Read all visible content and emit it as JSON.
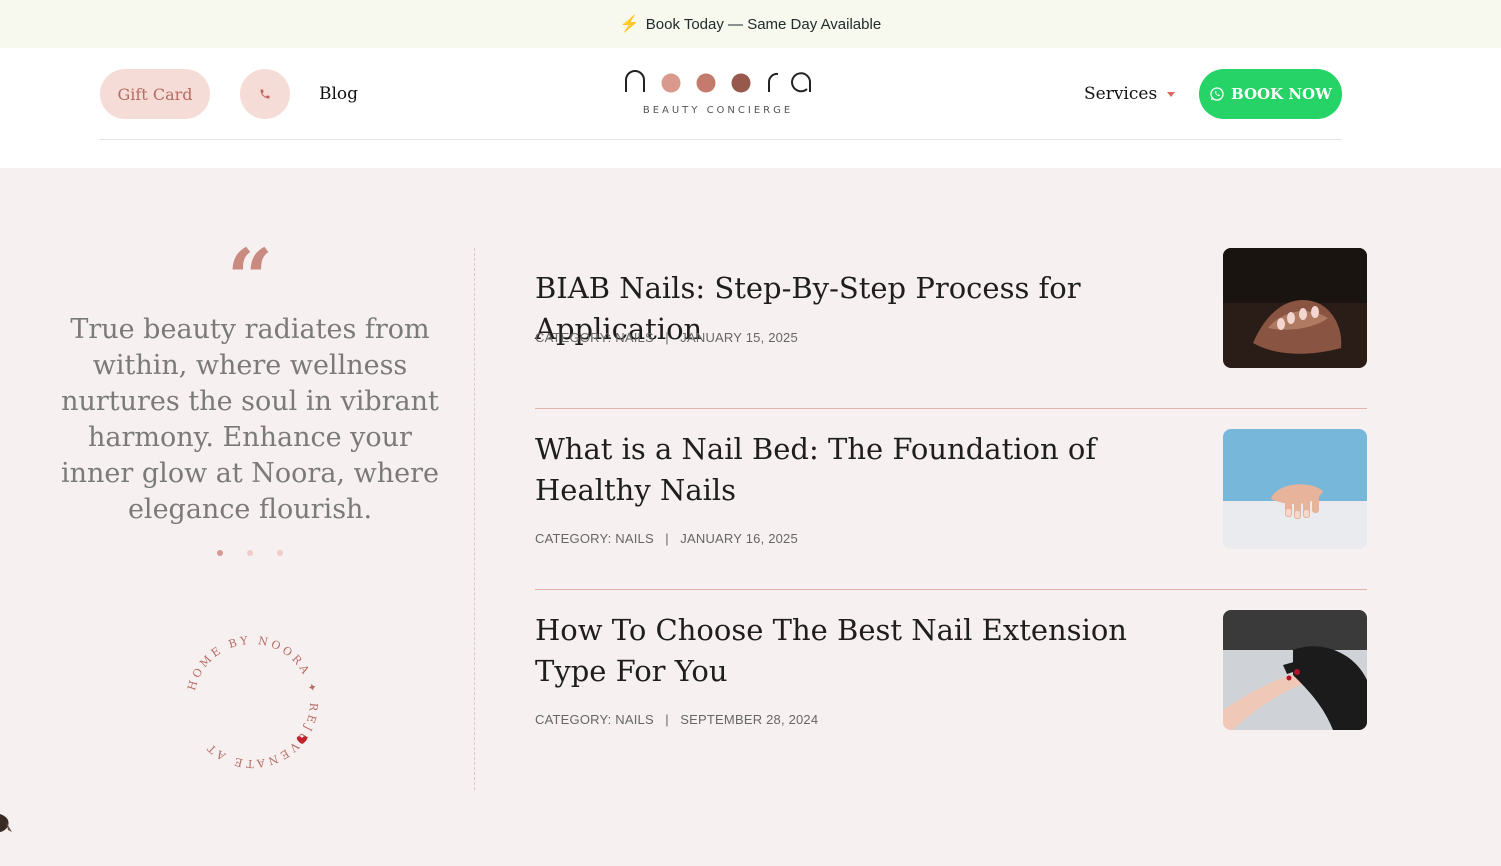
{
  "announcement": {
    "icon": "lightning-icon",
    "text": "Book Today — Same Day Available"
  },
  "header": {
    "gift_card_label": "Gift Card",
    "phone_icon": "phone-icon",
    "blog_label": "Blog",
    "logo_tagline": "BEAUTY CONCIERGE",
    "services_label": "Services",
    "book_now_label": "BOOK NOW",
    "book_now_icon": "whatsapp-icon"
  },
  "testimonial": {
    "quote_icon": "quote-icon",
    "text": "True beauty radiates from within, where wellness nurtures the soul in vibrant harmony. Enhance your inner glow at Noora, where elegance flourish.",
    "badge_text": "HOME BY NOORA ✦ REJUVENATE AT "
  },
  "posts": [
    {
      "title": "BIAB Nails: Step-By-Step Process for Application",
      "category": "CATEGORY: NAILS",
      "date": "JANUARY 15, 2025"
    },
    {
      "title": "What is a Nail Bed: The Foundation of Healthy Nails",
      "category": "CATEGORY: NAILS",
      "date": "JANUARY 16, 2025"
    },
    {
      "title": "How To Choose The Best Nail Extension Type For You",
      "category": "CATEGORY: NAILS",
      "date": "SEPTEMBER 28, 2024"
    }
  ],
  "colors": {
    "accent_pink": "#f6dcd6",
    "accent_brown": "#c98a80",
    "whatsapp_green": "#25d366",
    "page_bg": "#f7f0f0"
  }
}
